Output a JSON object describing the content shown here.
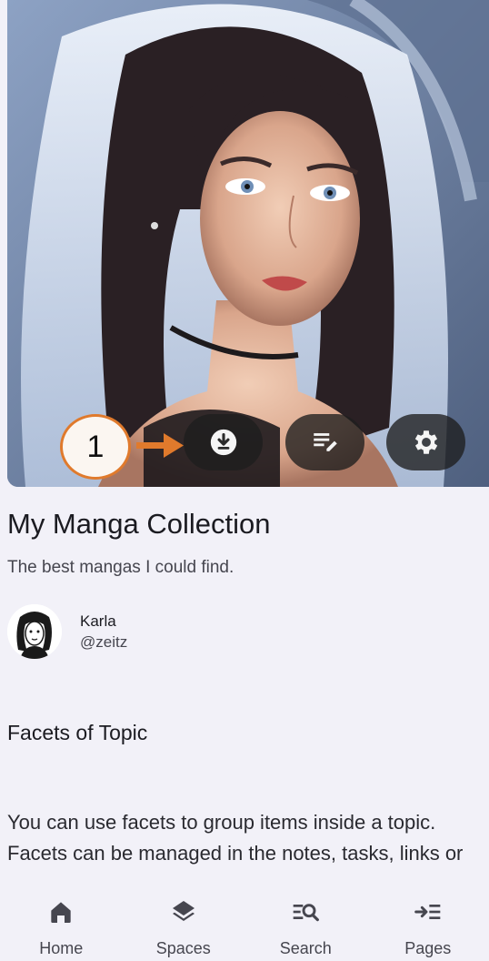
{
  "collection": {
    "title": "My Manga Collection",
    "description": "The best mangas I could find."
  },
  "author": {
    "name": "Karla",
    "handle": "@zeitz"
  },
  "hero_actions": [
    {
      "icon": "download-icon"
    },
    {
      "icon": "edit-notes-icon"
    },
    {
      "icon": "settings-gear-icon"
    }
  ],
  "callout": {
    "number": "1",
    "color": "#e07a2c"
  },
  "section": {
    "title": "Facets of Topic",
    "body_line1": "You can use facets to group items inside a topic.",
    "body_line2": "Facets can be managed in the notes, tasks, links or"
  },
  "nav": {
    "items": [
      {
        "label": "Home",
        "icon": "home-icon"
      },
      {
        "label": "Spaces",
        "icon": "layers-icon"
      },
      {
        "label": "Search",
        "icon": "search-list-icon"
      },
      {
        "label": "Pages",
        "icon": "pages-arrow-icon"
      }
    ]
  }
}
